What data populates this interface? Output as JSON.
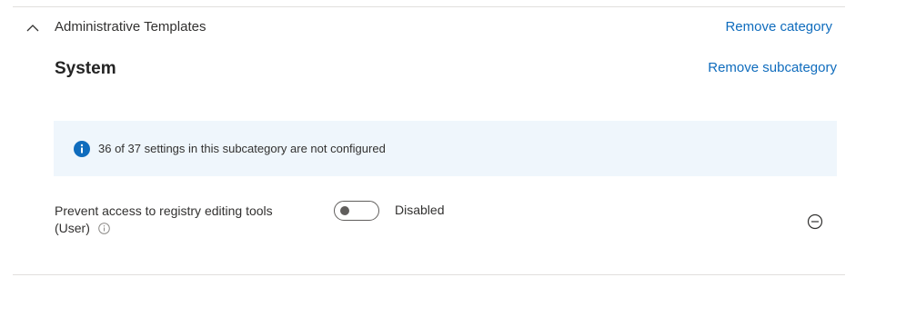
{
  "category": {
    "title": "Administrative Templates",
    "remove_label": "Remove category",
    "toggle_icon": "chevron-up-icon"
  },
  "subcategory": {
    "title": "System",
    "remove_label": "Remove subcategory"
  },
  "info_banner": {
    "icon": "info-icon",
    "text": "36 of 37 settings in this subcategory are not configured",
    "accent_color": "#0f6cbd",
    "background_color": "#eff6fc"
  },
  "setting": {
    "name_line1": "Prevent access to registry editing tools",
    "name_line2": "(User)",
    "tooltip_icon": "info-outline-icon",
    "toggle_state": "off",
    "toggle_label": "Disabled",
    "remove_icon": "minus-circle-icon"
  },
  "colors": {
    "link": "#0f6cbd",
    "text": "#323130",
    "divider": "#e1dfdd"
  }
}
